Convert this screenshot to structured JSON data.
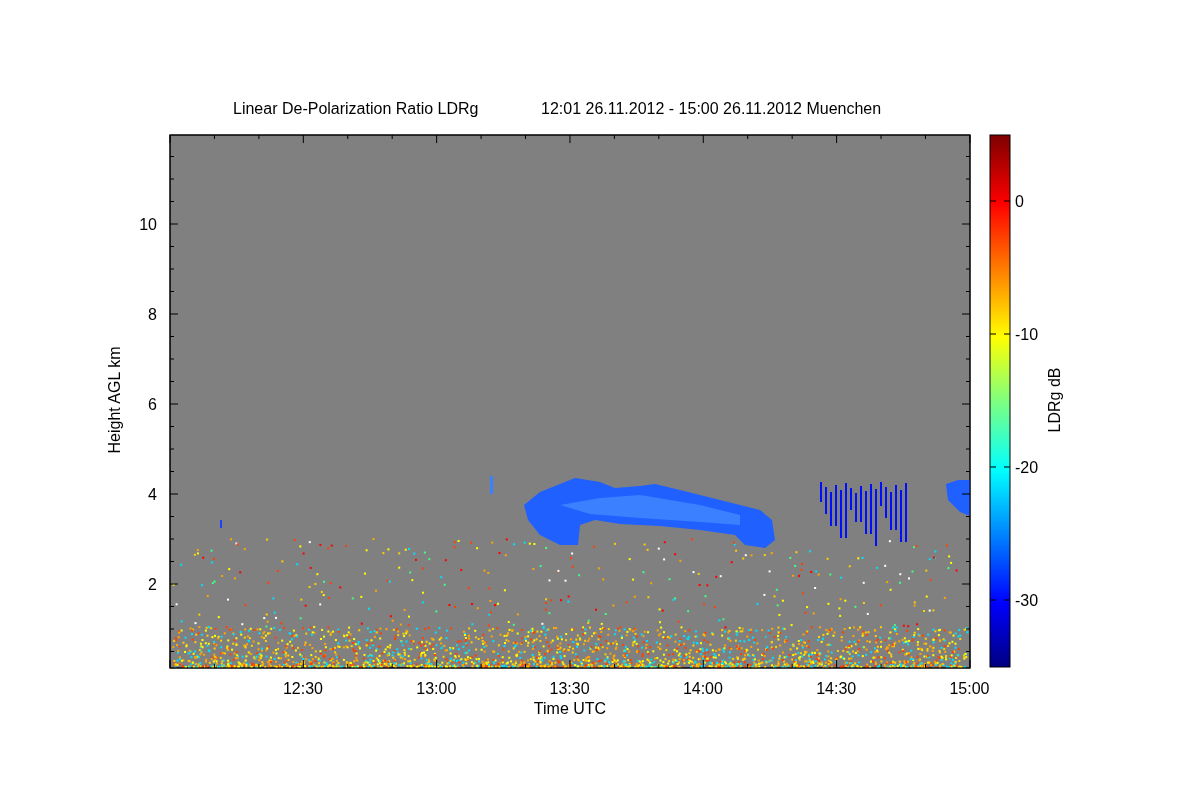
{
  "title": {
    "main": "Linear De-Polarization Ratio LDRg",
    "period": "12:01 26.11.2012 - 15:00 26.11.2012 Muenchen"
  },
  "plot": {
    "xlabel": "Time UTC",
    "ylabel": "Height AGL km",
    "xticks": [
      "12:30",
      "13:00",
      "13:30",
      "14:00",
      "14:30",
      "15:00"
    ],
    "yticks": [
      "10",
      "8",
      "6",
      "4",
      "2"
    ]
  },
  "colorbar": {
    "label": "LDRg dB",
    "ticks": [
      "0",
      "-10",
      "-20",
      "-30"
    ]
  }
}
